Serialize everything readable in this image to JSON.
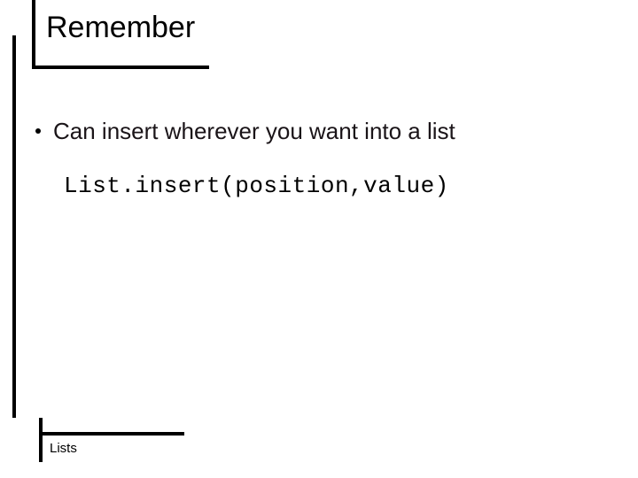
{
  "slide": {
    "title": "Remember",
    "bullet": "Can insert wherever you want into a list",
    "code": "List.insert(position,value)",
    "footer": "Lists"
  }
}
